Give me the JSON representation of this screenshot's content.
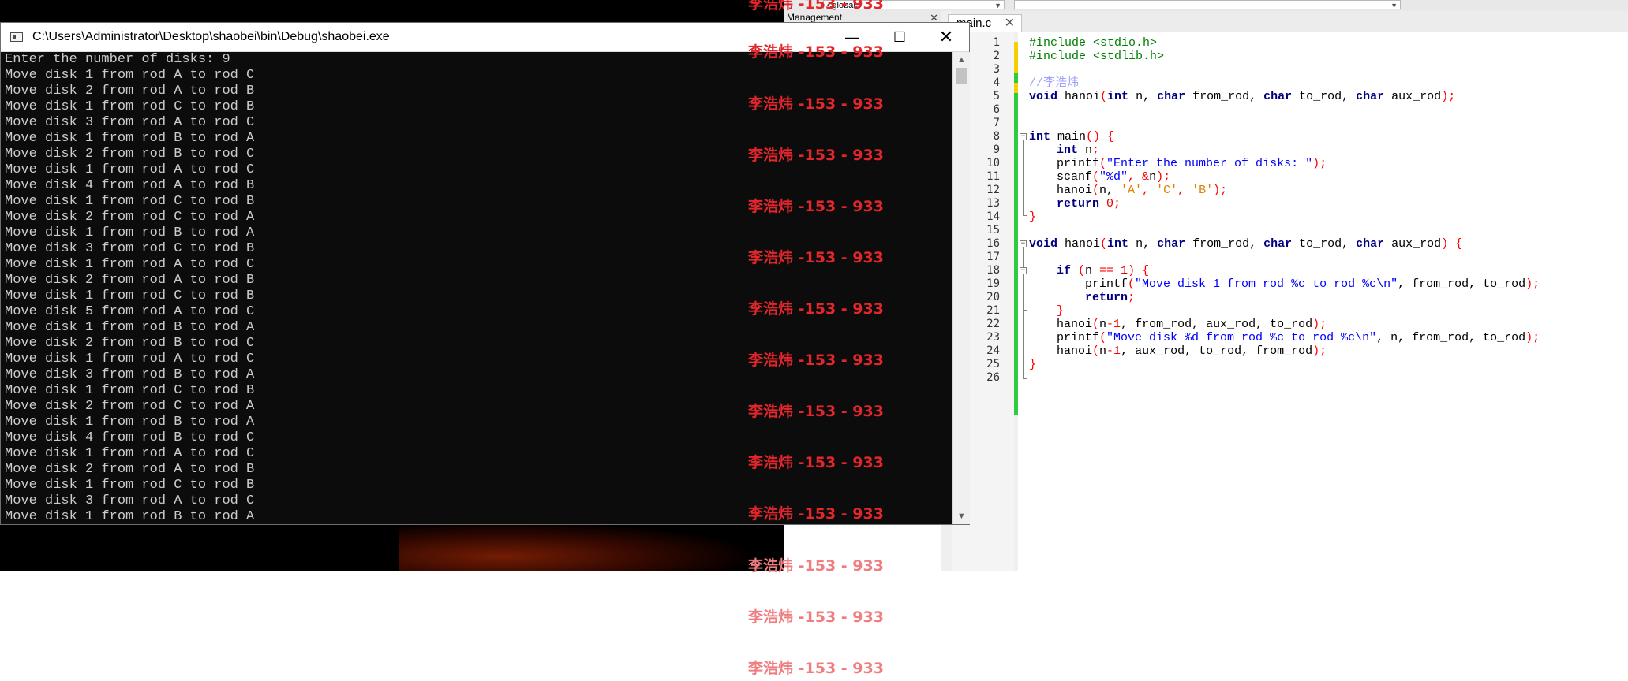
{
  "console": {
    "title": "C:\\Users\\Administrator\\Desktop\\shaobei\\bin\\Debug\\shaobei.exe",
    "minimize_glyph": "—",
    "maximize_glyph": "☐",
    "close_glyph": "✕",
    "lines": [
      "Enter the number of disks: 9",
      "Move disk 1 from rod A to rod C",
      "Move disk 2 from rod A to rod B",
      "Move disk 1 from rod C to rod B",
      "Move disk 3 from rod A to rod C",
      "Move disk 1 from rod B to rod A",
      "Move disk 2 from rod B to rod C",
      "Move disk 1 from rod A to rod C",
      "Move disk 4 from rod A to rod B",
      "Move disk 1 from rod C to rod B",
      "Move disk 2 from rod C to rod A",
      "Move disk 1 from rod B to rod A",
      "Move disk 3 from rod C to rod B",
      "Move disk 1 from rod A to rod C",
      "Move disk 2 from rod A to rod B",
      "Move disk 1 from rod C to rod B",
      "Move disk 5 from rod A to rod C",
      "Move disk 1 from rod B to rod A",
      "Move disk 2 from rod B to rod C",
      "Move disk 1 from rod A to rod C",
      "Move disk 3 from rod B to rod A",
      "Move disk 1 from rod C to rod B",
      "Move disk 2 from rod C to rod A",
      "Move disk 1 from rod B to rod A",
      "Move disk 4 from rod B to rod C",
      "Move disk 1 from rod A to rod C",
      "Move disk 2 from rod A to rod B",
      "Move disk 1 from rod C to rod B",
      "Move disk 3 from rod A to rod C",
      "Move disk 1 from rod B to rod A"
    ]
  },
  "ide": {
    "scope_dropdown": "<global>",
    "management_title": "Management",
    "tab_label": "main.c",
    "tab_close": "✕",
    "line_numbers": [
      "1",
      "2",
      "3",
      "4",
      "5",
      "6",
      "7",
      "8",
      "9",
      "10",
      "11",
      "12",
      "13",
      "14",
      "15",
      "16",
      "17",
      "18",
      "19",
      "20",
      "21",
      "22",
      "23",
      "24",
      "25",
      "26"
    ],
    "code": {
      "l1_inc": "#include <stdio.h>",
      "l2_inc": "#include <stdlib.h>",
      "l4_comment": "//李浩炜",
      "l5_void": "void",
      "l5_name": " hanoi",
      "l5_paren": "(",
      "l5_int": "int",
      "l5_n": " n, ",
      "l5_char1": "char",
      "l5_from": " from_rod, ",
      "l5_char2": "char",
      "l5_to": " to_rod, ",
      "l5_char3": "char",
      "l5_aux": " aux_rod",
      "l5_end": ");",
      "l8_int": "int",
      "l8_main": " main",
      "l8_paren": "() {",
      "l9_int": "int",
      "l9_n": " n",
      "l9_semi": ";",
      "l10_fn": "printf",
      "l10_p": "(",
      "l10_str": "\"Enter the number of disks: \"",
      "l10_end": ");",
      "l11_fn": "scanf",
      "l11_p": "(",
      "l11_str": "\"%d\"",
      "l11_mid": ", &",
      "l11_n": "n",
      "l11_end": ");",
      "l12_fn": "hanoi",
      "l12_p": "(",
      "l12_n": "n, ",
      "l12_a": "'A'",
      "l12_c1": ", ",
      "l12_c": "'C'",
      "l12_c2": ", ",
      "l12_b": "'B'",
      "l12_end": ");",
      "l13_ret": "return",
      "l13_zero": " 0",
      "l13_semi": ";",
      "l14": "}",
      "l16_void": "void",
      "l16_name": " hanoi",
      "l16_paren": "(",
      "l16_int": "int",
      "l16_n": " n, ",
      "l16_char1": "char",
      "l16_from": " from_rod, ",
      "l16_char2": "char",
      "l16_to": " to_rod, ",
      "l16_char3": "char",
      "l16_aux": " aux_rod",
      "l16_end": ") {",
      "l18_if": "if",
      "l18_open": " (",
      "l18_n": "n ",
      "l18_eq": "==",
      "l18_one": " 1",
      "l18_end": ") {",
      "l19_fn": "printf",
      "l19_p": "(",
      "l19_str": "\"Move disk 1 from rod %c to rod %c\\n\"",
      "l19_args": ", from_rod, to_rod",
      "l19_end": ");",
      "l20_ret": "return",
      "l20_semi": ";",
      "l21": "}",
      "l22_fn": "hanoi",
      "l22_p": "(",
      "l22_n": "n",
      "l22_minus": "-1",
      "l22_args": ", from_rod, aux_rod, to_rod",
      "l22_end": ");",
      "l23_fn": "printf",
      "l23_p": "(",
      "l23_str": "\"Move disk %d from rod %c to rod %c\\n\"",
      "l23_args": ", n, from_rod, to_rod",
      "l23_end": ");",
      "l24_fn": "hanoi",
      "l24_p": "(",
      "l24_n": "n",
      "l24_minus": "-1",
      "l24_args": ", aux_rod, to_rod, from_rod",
      "l24_end": ");",
      "l25": "}"
    }
  },
  "watermark": {
    "text": "李浩炜 -153 - 933",
    "count": 14
  },
  "colors": {
    "watermark": "#e3262b",
    "console_bg": "#0c0c0c",
    "console_text": "#cccccc",
    "keyword": "#000080",
    "preprocessor": "#008000",
    "string": "#0000ff",
    "char_literal": "#e08000",
    "operator": "#ff0000",
    "comment": "#a0a0ff",
    "change_saved": "#2ecc40",
    "change_unsaved": "#f5d000"
  }
}
